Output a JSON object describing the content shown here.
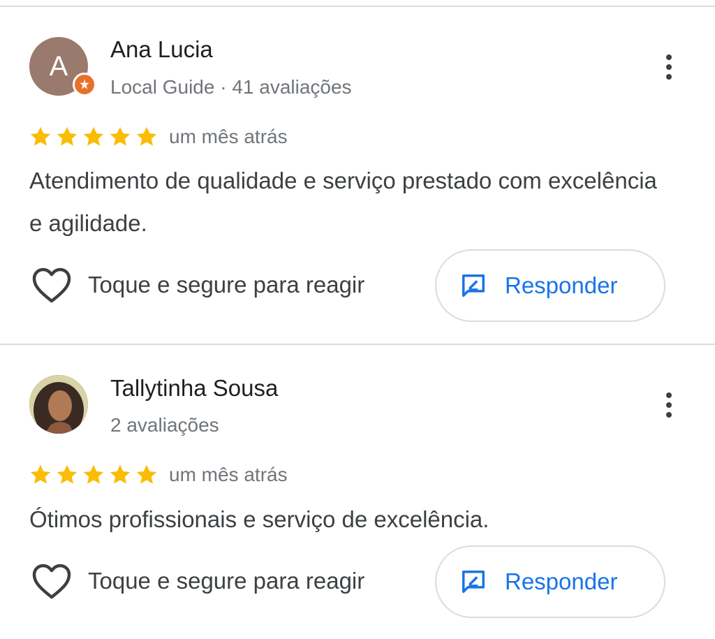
{
  "colors": {
    "star": "#fbbc04",
    "accent": "#1a73e8",
    "local_guide_badge": "#e8702a",
    "avatar_ana": "#9a7a6c"
  },
  "reviews": [
    {
      "avatar_letter": "A",
      "name": "Ana Lucia",
      "meta": "Local Guide · 41 avaliações",
      "rating": 5,
      "date": "um mês atrás",
      "text": "Atendimento de qualidade e serviço prestado com excelência e agilidade.",
      "react_label": "Toque e segure para reagir",
      "reply_label": "Responder",
      "icons": [
        "local-guide-badge-icon",
        "more-options-icon",
        "star-icon",
        "heart-icon",
        "reply-edit-icon"
      ]
    },
    {
      "name": "Tallytinha Sousa",
      "meta": "2 avaliações",
      "rating": 5,
      "date": "um mês atrás",
      "text": "Ótimos profissionais e serviço de excelência.",
      "react_label": "Toque e segure para reagir",
      "reply_label": "Responder",
      "icons": [
        "more-options-icon",
        "star-icon",
        "heart-icon",
        "reply-edit-icon"
      ]
    }
  ]
}
